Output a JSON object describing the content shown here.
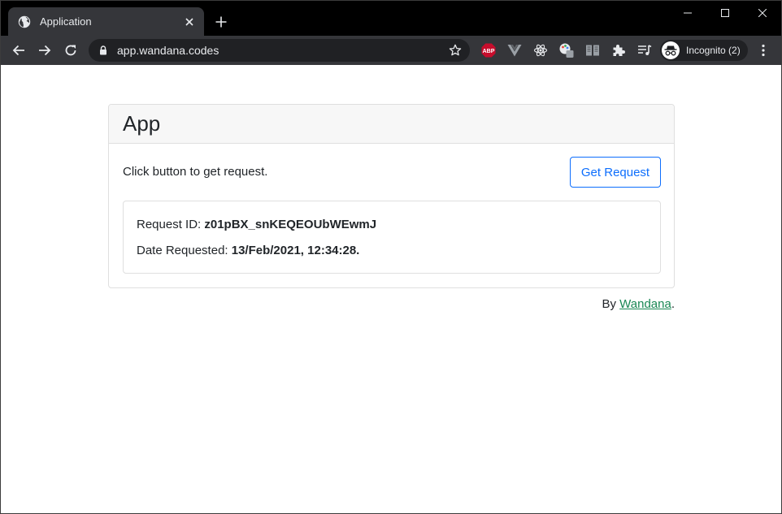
{
  "browser": {
    "tab": {
      "title": "Application",
      "favicon": "globe-icon"
    },
    "url": "app.wandana.codes",
    "extensions": [
      {
        "name": "adblock-plus-icon",
        "label": "ABP",
        "color": "#c70d2c"
      },
      {
        "name": "vue-devtools-icon"
      },
      {
        "name": "react-devtools-icon"
      },
      {
        "name": "color-picker-icon"
      },
      {
        "name": "reader-icon"
      },
      {
        "name": "puzzle-icon"
      },
      {
        "name": "media-queue-icon"
      }
    ],
    "profile": {
      "label": "Incognito (2)",
      "icon": "incognito-icon"
    }
  },
  "page": {
    "card_title": "App",
    "prompt": "Click button to get request.",
    "button_label": "Get Request",
    "request_id_label": "Request ID: ",
    "request_id": "z01pBX_snKEQEOUbWEwmJ",
    "date_label": "Date Requested: ",
    "date_value": "13/Feb/2021, 12:34:28.",
    "footer_prefix": "By ",
    "footer_link": "Wandana",
    "footer_suffix": "."
  },
  "colors": {
    "accent": "#0d6efd",
    "link": "#198754",
    "tab_bg": "#35363a",
    "frame_bg": "#000000"
  }
}
